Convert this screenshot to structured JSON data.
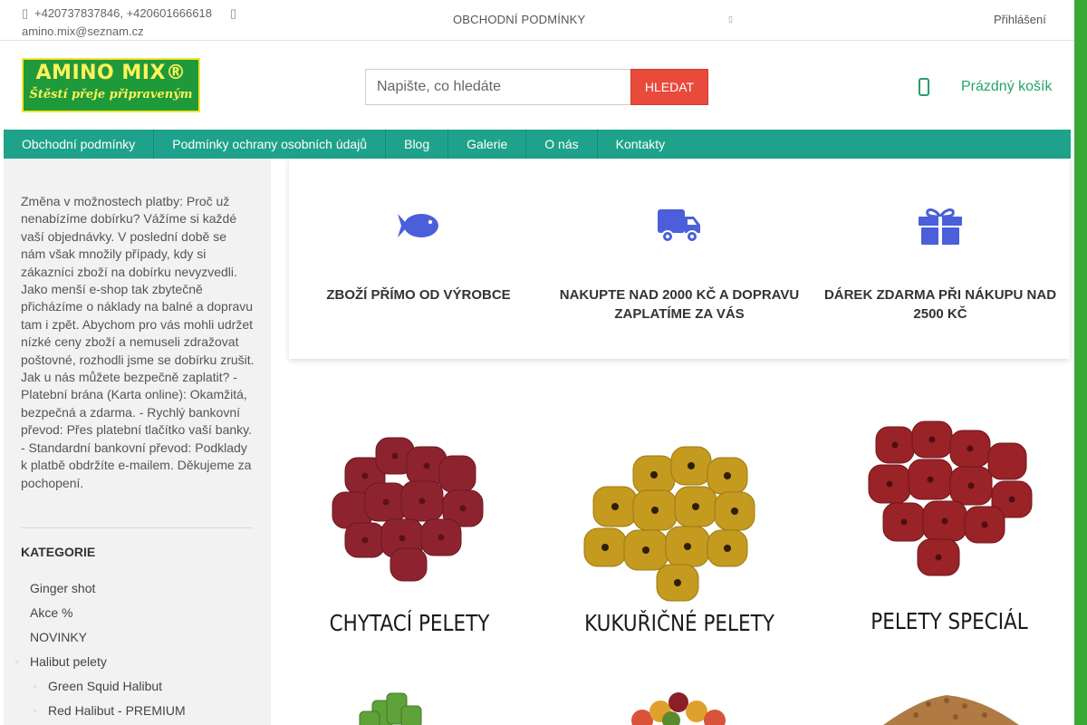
{
  "topbar": {
    "phones": "+420737837846, +420601666618",
    "email": "amino.mix@seznam.cz",
    "terms": "OBCHODNÍ PODMÍNKY",
    "login": "Přihlášení"
  },
  "header": {
    "logo_title": "AMINO MIX®",
    "logo_slogan": "Štěstí přeje připraveným",
    "search_placeholder": "Napište, co hledáte",
    "search_button": "HLEDAT",
    "cart_label": "Prázdný košík"
  },
  "nav": {
    "items": [
      "Obchodní podmínky",
      "Podmínky ochrany osobních údajů",
      "Blog",
      "Galerie",
      "O nás",
      "Kontakty"
    ]
  },
  "sidebar": {
    "notice": "Změna v možnostech platby: Proč už nenabízíme dobírku? Vážíme si každé vaší objednávky. V poslední době se nám však množily případy, kdy si zákazníci zboží na dobírku nevyzvedli. Jako menší e-shop tak zbytečně přicházíme o náklady na balné a dopravu tam i zpět. Abychom pro vás mohli udržet nízké ceny zboží a nemuseli zdražovat poštovné, rozhodli jsme se dobírku zrušit. Jak u nás můžete bezpečně zaplatit? - Platební brána (Karta online): Okamžitá, bezpečná a zdarma. - Rychlý bankovní převod: Přes platební tlačítko vaší banky. - Standardní bankovní převod: Podklady k platbě obdržíte e-mailem. Děkujeme za pochopení.",
    "category_title": "KATEGORIE",
    "categories": [
      {
        "label": "Ginger shot",
        "level": 0,
        "bullet": false
      },
      {
        "label": "Akce %",
        "level": 0,
        "bullet": false
      },
      {
        "label": "NOVINKY",
        "level": 0,
        "bullet": false
      },
      {
        "label": "Halibut pelety",
        "level": 0,
        "bullet": true
      },
      {
        "label": "Green Squid Halibut",
        "level": 1,
        "bullet": true
      },
      {
        "label": "Red Halibut - PREMIUM",
        "level": 1,
        "bullet": true
      }
    ]
  },
  "features": [
    {
      "icon": "fish-icon",
      "text": "ZBOŽÍ PŘÍMO OD VÝROBCE"
    },
    {
      "icon": "truck-icon",
      "text": "NAKUPTE NAD 2000 KČ A DOPRAVU ZAPLATÍME ZA VÁS"
    },
    {
      "icon": "gift-icon",
      "text": "DÁREK ZDARMA PŘI NÁKUPU NAD 2500 KČ"
    }
  ],
  "category_tiles": [
    {
      "caption": "CHYTACÍ PELETY"
    },
    {
      "caption": "KUKUŘIČNÉ PELETY"
    },
    {
      "caption": "PELETY SPECIÁL"
    }
  ],
  "colors": {
    "accent": "#1fa28c",
    "icon": "#4a5fd9",
    "search_button": "#e84a3c",
    "page_bg": "#39a935",
    "cart": "#25a36b"
  }
}
